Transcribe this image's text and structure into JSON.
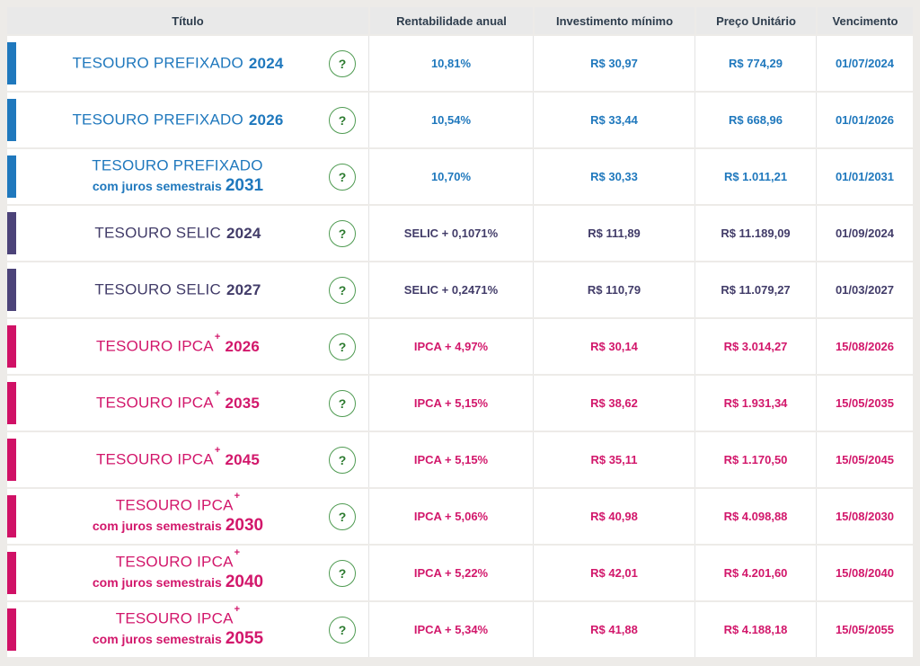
{
  "page": {
    "background": "#edebe8"
  },
  "colors": {
    "prefixado": {
      "bar": "#1f78bd",
      "text": "#1f78bd"
    },
    "selic": {
      "bar": "#4c4379",
      "text": "#423c69"
    },
    "ipca": {
      "bar": "#d01166",
      "text": "#d2176b"
    },
    "header_bg": "#e9e9e9",
    "header_text": "#2e3d4d",
    "help_ring": "#4f9b52",
    "help_text": "#2b7a2e",
    "row_bg": "#ffffff"
  },
  "table": {
    "columns": [
      "Título",
      "Rentabilidade anual",
      "Investimento mínimo",
      "Preço Unitário",
      "Vencimento"
    ],
    "help_label": "?",
    "rows": [
      {
        "group": "prefixado",
        "title": "TESOURO PREFIXADO",
        "superscript": "",
        "subtitle": "",
        "year": "2024",
        "annual_yield": "10,81%",
        "min_investment": "R$ 30,97",
        "unit_price": "R$ 774,29",
        "maturity": "01/07/2024"
      },
      {
        "group": "prefixado",
        "title": "TESOURO PREFIXADO",
        "superscript": "",
        "subtitle": "",
        "year": "2026",
        "annual_yield": "10,54%",
        "min_investment": "R$ 33,44",
        "unit_price": "R$ 668,96",
        "maturity": "01/01/2026"
      },
      {
        "group": "prefixado",
        "title": "TESOURO PREFIXADO",
        "superscript": "",
        "subtitle": "com juros semestrais",
        "year": "2031",
        "annual_yield": "10,70%",
        "min_investment": "R$ 30,33",
        "unit_price": "R$ 1.011,21",
        "maturity": "01/01/2031"
      },
      {
        "group": "selic",
        "title": "TESOURO SELIC",
        "superscript": "",
        "subtitle": "",
        "year": "2024",
        "annual_yield": "SELIC + 0,1071%",
        "min_investment": "R$ 111,89",
        "unit_price": "R$ 11.189,09",
        "maturity": "01/09/2024"
      },
      {
        "group": "selic",
        "title": "TESOURO SELIC",
        "superscript": "",
        "subtitle": "",
        "year": "2027",
        "annual_yield": "SELIC + 0,2471%",
        "min_investment": "R$ 110,79",
        "unit_price": "R$ 11.079,27",
        "maturity": "01/03/2027"
      },
      {
        "group": "ipca",
        "title": "TESOURO IPCA",
        "superscript": "+",
        "subtitle": "",
        "year": "2026",
        "annual_yield": "IPCA + 4,97%",
        "min_investment": "R$ 30,14",
        "unit_price": "R$ 3.014,27",
        "maturity": "15/08/2026"
      },
      {
        "group": "ipca",
        "title": "TESOURO IPCA",
        "superscript": "+",
        "subtitle": "",
        "year": "2035",
        "annual_yield": "IPCA + 5,15%",
        "min_investment": "R$ 38,62",
        "unit_price": "R$ 1.931,34",
        "maturity": "15/05/2035"
      },
      {
        "group": "ipca",
        "title": "TESOURO IPCA",
        "superscript": "+",
        "subtitle": "",
        "year": "2045",
        "annual_yield": "IPCA + 5,15%",
        "min_investment": "R$ 35,11",
        "unit_price": "R$ 1.170,50",
        "maturity": "15/05/2045"
      },
      {
        "group": "ipca",
        "title": "TESOURO IPCA",
        "superscript": "+",
        "subtitle": "com juros semestrais",
        "year": "2030",
        "annual_yield": "IPCA + 5,06%",
        "min_investment": "R$ 40,98",
        "unit_price": "R$ 4.098,88",
        "maturity": "15/08/2030"
      },
      {
        "group": "ipca",
        "title": "TESOURO IPCA",
        "superscript": "+",
        "subtitle": "com juros semestrais",
        "year": "2040",
        "annual_yield": "IPCA + 5,22%",
        "min_investment": "R$ 42,01",
        "unit_price": "R$ 4.201,60",
        "maturity": "15/08/2040"
      },
      {
        "group": "ipca",
        "title": "TESOURO IPCA",
        "superscript": "+",
        "subtitle": "com juros semestrais",
        "year": "2055",
        "annual_yield": "IPCA + 5,34%",
        "min_investment": "R$ 41,88",
        "unit_price": "R$ 4.188,18",
        "maturity": "15/05/2055"
      }
    ]
  }
}
